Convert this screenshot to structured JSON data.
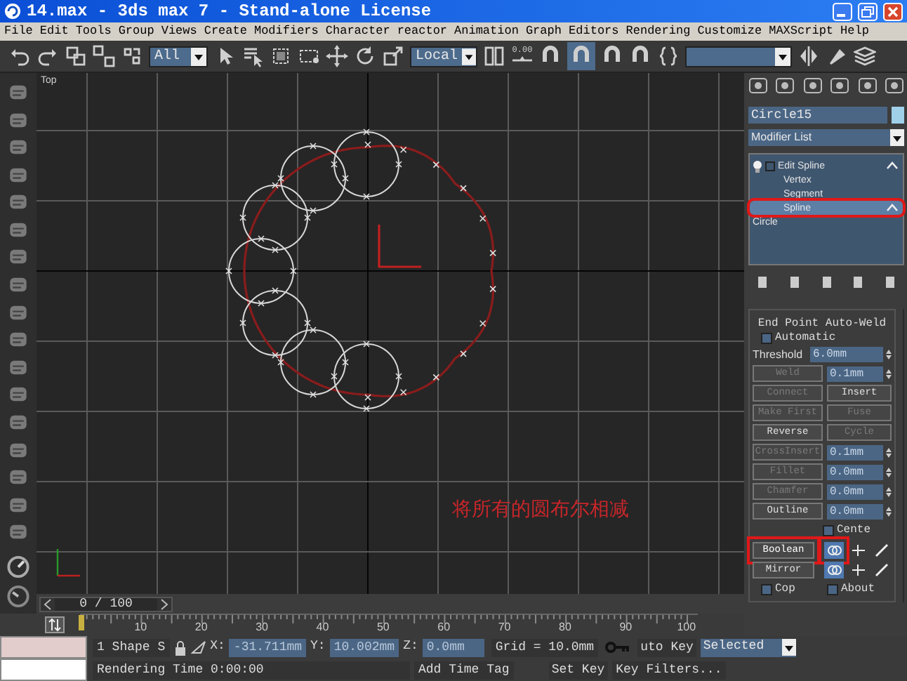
{
  "window": {
    "title": "14.max - 3ds max 7  - Stand-alone License"
  },
  "menu": [
    "File",
    "Edit",
    "Tools",
    "Group",
    "Views",
    "Create",
    "Modifiers",
    "Character",
    "reactor",
    "Animation",
    "Graph Editors",
    "Rendering",
    "Customize",
    "MAXScript",
    "Help"
  ],
  "toolbar": {
    "selection_filter": "All",
    "reference_coord": "Local",
    "spinner_label": "0.00"
  },
  "viewport": {
    "label": "Top",
    "annotation": "将所有的圆布尔相减"
  },
  "command_panel": {
    "object_name": "Circle15",
    "modifier_list": "Modifier List",
    "stack": [
      {
        "label": "Edit Spline",
        "selected": false,
        "annotated": false,
        "children": [
          {
            "label": "Vertex",
            "selected": false,
            "annotated": false
          },
          {
            "label": "Segment",
            "selected": false,
            "annotated": false
          },
          {
            "label": "Spline",
            "selected": true,
            "annotated": true
          }
        ]
      },
      {
        "label": "Circle",
        "selected": false,
        "annotated": false
      }
    ],
    "rollout": {
      "title": "End Point Auto-Weld",
      "automatic": {
        "label": "Automatic",
        "checked": false
      },
      "threshold": {
        "label": "Threshold",
        "value": "6.0mm"
      },
      "rows": [
        {
          "kind": "button_spinner",
          "button": {
            "label": "Weld",
            "disabled": true
          },
          "value": "0.1mm"
        },
        {
          "kind": "button_pair",
          "buttons": [
            {
              "label": "Connect",
              "disabled": true
            },
            {
              "label": "Insert",
              "disabled": false
            }
          ]
        },
        {
          "kind": "button_pair",
          "buttons": [
            {
              "label": "Make First",
              "disabled": true
            },
            {
              "label": "Fuse",
              "disabled": true
            }
          ]
        },
        {
          "kind": "button_pair",
          "buttons": [
            {
              "label": "Reverse",
              "disabled": false
            },
            {
              "label": "Cycle",
              "disabled": true
            }
          ]
        },
        {
          "kind": "button_spinner",
          "button": {
            "label": "CrossInsert",
            "disabled": true
          },
          "value": "0.1mm"
        },
        {
          "kind": "button_spinner",
          "button": {
            "label": "Fillet",
            "disabled": true
          },
          "value": "0.0mm"
        },
        {
          "kind": "button_spinner",
          "button": {
            "label": "Chamfer",
            "disabled": true
          },
          "value": "0.0mm"
        },
        {
          "kind": "button_spinner",
          "button": {
            "label": "Outline",
            "disabled": false
          },
          "value": "0.0mm"
        },
        {
          "kind": "checkbox",
          "label": "Cente",
          "checked": false
        },
        {
          "kind": "operations",
          "button": {
            "label": "Boolean",
            "selected": true,
            "annotated": true
          },
          "options": [
            {
              "selected": true,
              "annotated": true
            },
            {
              "selected": false,
              "annotated": false
            },
            {
              "selected": false,
              "annotated": false
            }
          ]
        },
        {
          "kind": "operations",
          "button": {
            "label": "Mirror",
            "selected": false,
            "annotated": false
          },
          "options": [
            {
              "selected": true,
              "annotated": false
            },
            {
              "selected": false,
              "annotated": false
            },
            {
              "selected": false,
              "annotated": false
            }
          ]
        },
        {
          "kind": "checkbox_pair",
          "items": [
            {
              "label": "Cop",
              "checked": false
            },
            {
              "label": "About",
              "checked": false
            }
          ]
        }
      ]
    }
  },
  "timeline": {
    "position": "0 / 100",
    "ticks": [
      "10",
      "20",
      "30",
      "40",
      "50",
      "60",
      "70",
      "80",
      "90",
      "100"
    ]
  },
  "status": {
    "selection": "1 Shape S",
    "x_label": "X:",
    "x": "-31.711mm",
    "y_label": "Y:",
    "y": "10.002mm",
    "z_label": "Z:",
    "z": "0.0mm",
    "grid": "Grid = 10.0mm",
    "auto_key": "uto Key",
    "key_mode": "Selected",
    "rendering_label": "Rendering Time  0:00:00",
    "add_time_tag": "Add Time Tag",
    "set_key": "Set Key",
    "key_filters": "Key Filters..."
  }
}
